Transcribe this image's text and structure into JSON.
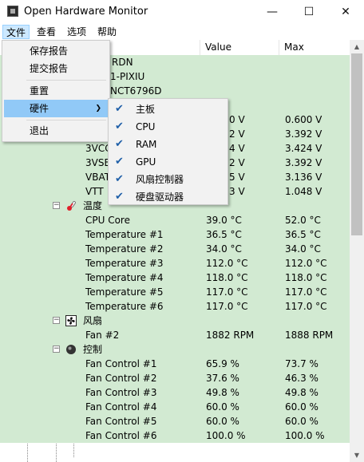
{
  "window": {
    "title": "Open Hardware Monitor",
    "minimize_glyph": "—",
    "maximize_glyph": "☐",
    "close_glyph": "✕"
  },
  "menubar": {
    "items": [
      "文件",
      "查看",
      "选项",
      "帮助"
    ]
  },
  "columns": {
    "value": "Value",
    "max": "Max"
  },
  "rows": [
    {
      "name": "RDN",
      "value": "",
      "max": ""
    },
    {
      "name": "1-PIXIU",
      "value": "",
      "max": ""
    },
    {
      "name": "NCT6796D",
      "value": "",
      "max": ""
    },
    {
      "name": "",
      "value": "",
      "max": ""
    },
    {
      "name": "",
      "value": "0 V",
      "max": "0.600 V"
    },
    {
      "name": "",
      "value": "2 V",
      "max": "3.392 V"
    },
    {
      "name": "3VCC",
      "value": "4 V",
      "max": "3.424 V"
    },
    {
      "name": "3VSB",
      "value": "2 V",
      "max": "3.392 V"
    },
    {
      "name": "VBAT",
      "value": "5 V",
      "max": "3.136 V"
    },
    {
      "name": "VTT",
      "value": "3 V",
      "max": "1.048 V"
    },
    {
      "name": "温度",
      "value": "",
      "max": ""
    },
    {
      "name": "CPU Core",
      "value": "39.0 °C",
      "max": "52.0 °C"
    },
    {
      "name": "Temperature #1",
      "value": "36.5 °C",
      "max": "36.5 °C"
    },
    {
      "name": "Temperature #2",
      "value": "34.0 °C",
      "max": "34.0 °C"
    },
    {
      "name": "Temperature #3",
      "value": "112.0 °C",
      "max": "112.0 °C"
    },
    {
      "name": "Temperature #4",
      "value": "118.0 °C",
      "max": "118.0 °C"
    },
    {
      "name": "Temperature #5",
      "value": "117.0 °C",
      "max": "117.0 °C"
    },
    {
      "name": "Temperature #6",
      "value": "117.0 °C",
      "max": "117.0 °C"
    },
    {
      "name": "风扇",
      "value": "",
      "max": ""
    },
    {
      "name": "Fan #2",
      "value": "1882 RPM",
      "max": "1888 RPM"
    },
    {
      "name": "控制",
      "value": "",
      "max": ""
    },
    {
      "name": "Fan Control #1",
      "value": "65.9 %",
      "max": "73.7 %"
    },
    {
      "name": "Fan Control #2",
      "value": "37.6 %",
      "max": "46.3 %"
    },
    {
      "name": "Fan Control #3",
      "value": "49.8 %",
      "max": "49.8 %"
    },
    {
      "name": "Fan Control #4",
      "value": "60.0 %",
      "max": "60.0 %"
    },
    {
      "name": "Fan Control #5",
      "value": "60.0 %",
      "max": "60.0 %"
    },
    {
      "name": "Fan Control #6",
      "value": "100.0 %",
      "max": "100.0 %"
    }
  ],
  "file_menu": {
    "items": [
      "保存报告",
      "提交报告",
      "重置",
      "硬件",
      "退出"
    ],
    "submenu_arrow": "❯"
  },
  "hardware_submenu": {
    "check_glyph": "✔",
    "items": [
      "主板",
      "CPU",
      "RAM",
      "GPU",
      "风扇控制器",
      "硬盘驱动器"
    ]
  },
  "scrollbar": {
    "up_glyph": "▲",
    "down_glyph": "▼"
  },
  "colors": {
    "row_bg": "#d2ead2",
    "menu_highlight": "#91c9f7",
    "check": "#1f5fa8"
  },
  "icons": {
    "temperature_group": "thermometer-icon",
    "fan_group": "fan-icon",
    "control_group": "control-knob-icon"
  }
}
